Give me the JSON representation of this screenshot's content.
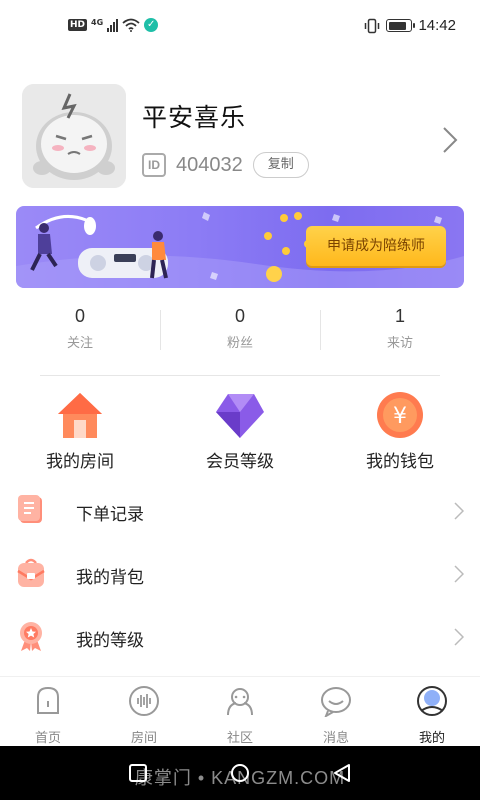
{
  "status_bar": {
    "hd": "HD",
    "network": "4G",
    "time": "14:42",
    "battery_level": 0.85
  },
  "profile": {
    "nickname": "平安喜乐",
    "id_icon_text": "ID",
    "id_number": "404032",
    "copy_label": "复制"
  },
  "banner": {
    "cta_label": "申请成为陪练师"
  },
  "stats": [
    {
      "value": "0",
      "label": "关注"
    },
    {
      "value": "0",
      "label": "粉丝"
    },
    {
      "value": "1",
      "label": "来访"
    }
  ],
  "features": [
    {
      "label": "我的房间",
      "icon": "house-icon"
    },
    {
      "label": "会员等级",
      "icon": "diamond-icon"
    },
    {
      "label": "我的钱包",
      "icon": "yen-coin-icon",
      "icon_text": "¥"
    }
  ],
  "menu": [
    {
      "label": "下单记录",
      "icon": "order-record-icon"
    },
    {
      "label": "我的背包",
      "icon": "backpack-icon"
    },
    {
      "label": "我的等级",
      "icon": "level-medal-icon"
    }
  ],
  "tabs": [
    {
      "label": "首页",
      "icon": "home-icon",
      "active": false
    },
    {
      "label": "房间",
      "icon": "voice-room-icon",
      "active": false
    },
    {
      "label": "社区",
      "icon": "community-icon",
      "active": false
    },
    {
      "label": "消息",
      "icon": "message-icon",
      "active": false
    },
    {
      "label": "我的",
      "icon": "profile-icon",
      "active": true
    }
  ],
  "watermark": "康掌门 • KANGZM.COM",
  "colors": {
    "accent_teal": "#1fbfa8",
    "banner_purple": "#8c7cf5",
    "cta_yellow": "#ffc82e",
    "active_tab_blue": "#4a7df0"
  }
}
